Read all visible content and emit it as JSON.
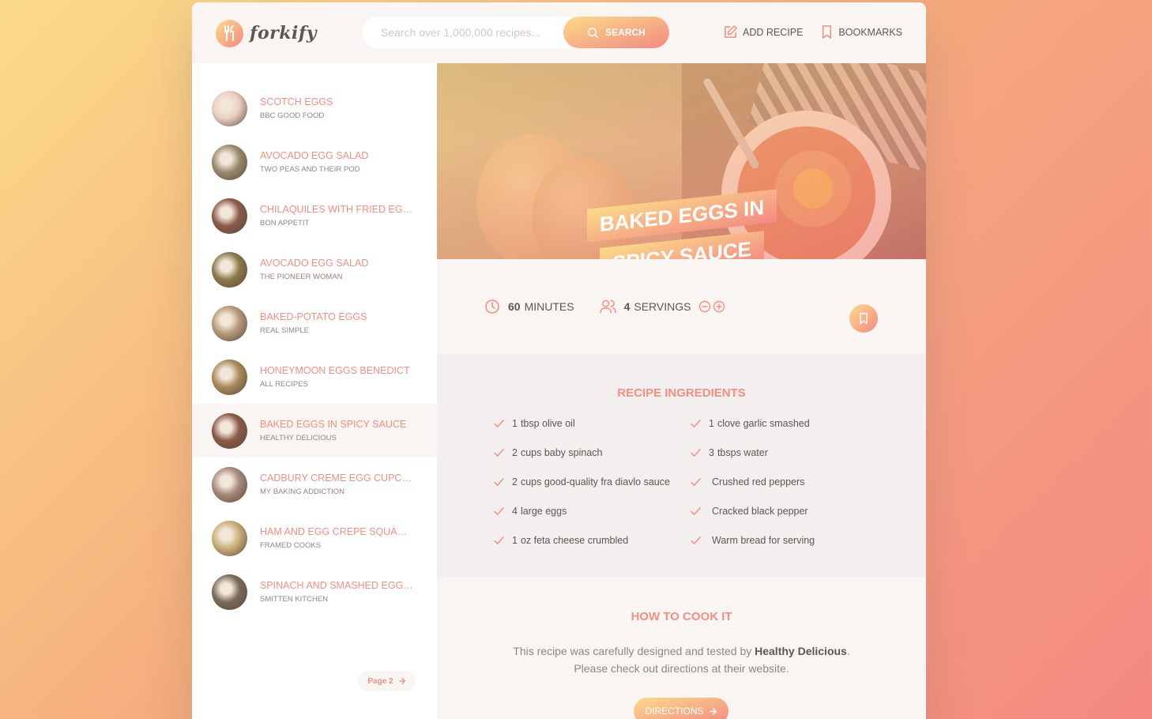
{
  "header": {
    "logo_text": "forkify",
    "search_placeholder": "Search over 1,000,000 recipes...",
    "search_button": "Search",
    "nav": {
      "add_recipe": "Add recipe",
      "bookmarks": "Bookmarks"
    }
  },
  "results": {
    "items": [
      {
        "title": "Scotch Eggs",
        "publisher": "BBC Good Food",
        "thumb_color": "#e8cfc0"
      },
      {
        "title": "Avocado Egg Salad",
        "publisher": "Two Peas and Their Pod",
        "thumb_color": "#9a8a6e"
      },
      {
        "title": "Chilaquiles with Fried Eggs",
        "publisher": "Bon Appetit",
        "thumb_color": "#8a5a4a"
      },
      {
        "title": "Avocado Egg Salad",
        "publisher": "The Pioneer Woman",
        "thumb_color": "#8b7a4a"
      },
      {
        "title": "Baked-Potato Eggs",
        "publisher": "Real Simple",
        "thumb_color": "#b59a7a"
      },
      {
        "title": "Honeymoon Eggs Benedict",
        "publisher": "All Recipes",
        "thumb_color": "#a88a5a"
      },
      {
        "title": "Baked Eggs in Spicy Sauce",
        "publisher": "Healthy Delicious",
        "thumb_color": "#8a5a48"
      },
      {
        "title": "Cadbury Creme Egg Cupcakes",
        "publisher": "My Baking Addiction",
        "thumb_color": "#a58a7a"
      },
      {
        "title": "Ham and Egg Crepe Squares",
        "publisher": "Framed Cooks",
        "thumb_color": "#c8b078"
      },
      {
        "title": "Spinach and Smashed Egg To...",
        "publisher": "Smitten Kitchen",
        "thumb_color": "#7a6a5a"
      }
    ],
    "active_index": 6,
    "pagination": {
      "label": "Page 2"
    }
  },
  "recipe": {
    "title": "Baked Eggs in Spicy Sauce",
    "cooking_time": "60",
    "cooking_time_unit": "minutes",
    "servings": "4",
    "servings_unit": "servings",
    "ingredients_heading": "Recipe ingredients",
    "ingredients": [
      {
        "qty": "1",
        "text": "tbsp olive oil"
      },
      {
        "qty": "1",
        "text": "clove garlic smashed"
      },
      {
        "qty": "2",
        "text": "cups baby spinach"
      },
      {
        "qty": "3",
        "text": "tbsps water"
      },
      {
        "qty": "2",
        "text": "cups good-quality fra diavlo sauce"
      },
      {
        "qty": "",
        "text": "Crushed red peppers"
      },
      {
        "qty": "4",
        "text": "large eggs"
      },
      {
        "qty": "",
        "text": "Cracked black pepper"
      },
      {
        "qty": "1",
        "text": "oz feta cheese crumbled"
      },
      {
        "qty": "",
        "text": "Warm bread for serving"
      }
    ],
    "directions_heading": "How to cook it",
    "directions_text_1": "This recipe was carefully designed and tested by ",
    "directions_publisher": "Healthy Delicious",
    "directions_text_2": ". Please check out directions at their website.",
    "directions_button": "Directions"
  },
  "colors": {
    "accent": "#f38e82",
    "gradient_start": "#fbdb89",
    "gradient_end": "#f48982",
    "text": "#615551",
    "muted": "#918581",
    "panel": "#f9f5f3"
  },
  "icons": {
    "logo": "fork-knife-icon",
    "search": "search-icon",
    "add_recipe": "edit-icon",
    "bookmarks": "bookmark-icon",
    "time": "clock-icon",
    "servings": "users-icon",
    "decrease": "minus-circle-icon",
    "increase": "plus-circle-icon",
    "check": "check-icon",
    "arrow": "arrow-right-icon"
  }
}
